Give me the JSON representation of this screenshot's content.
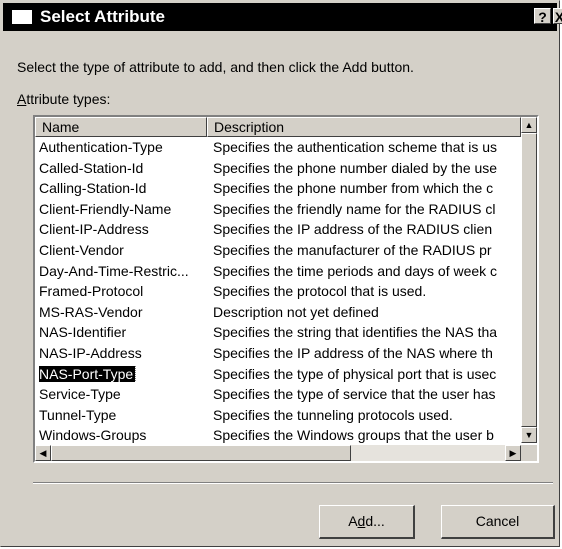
{
  "window": {
    "title": "Select Attribute",
    "help_glyph": "?",
    "close_glyph": "X"
  },
  "instruction": "Select the type of attribute to add, and then click the Add button.",
  "list": {
    "label_accel": "A",
    "label_rest": "ttribute types:",
    "columns": [
      "Name",
      "Description"
    ],
    "selected_index": 11,
    "rows": [
      {
        "name": "Authentication-Type",
        "description": "Specifies the authentication scheme that is us"
      },
      {
        "name": "Called-Station-Id",
        "description": "Specifies the phone number dialed by the use"
      },
      {
        "name": "Calling-Station-Id",
        "description": "Specifies the phone number from which the c"
      },
      {
        "name": "Client-Friendly-Name",
        "description": "Specifies the friendly name for the RADIUS cl"
      },
      {
        "name": "Client-IP-Address",
        "description": "Specifies the IP address of the RADIUS clien"
      },
      {
        "name": "Client-Vendor",
        "description": "Specifies the manufacturer of the RADIUS pr"
      },
      {
        "name": "Day-And-Time-Restric...",
        "description": "Specifies the time periods and days of week c"
      },
      {
        "name": "Framed-Protocol",
        "description": "Specifies the protocol that is used."
      },
      {
        "name": "MS-RAS-Vendor",
        "description": "Description not yet defined"
      },
      {
        "name": "NAS-Identifier",
        "description": "Specifies the string that identifies the NAS tha"
      },
      {
        "name": "NAS-IP-Address",
        "description": "Specifies the IP address of the NAS where th"
      },
      {
        "name": "NAS-Port-Type",
        "description": "Specifies the type of physical port that is usec"
      },
      {
        "name": "Service-Type",
        "description": "Specifies the type of service that the user has"
      },
      {
        "name": "Tunnel-Type",
        "description": "Specifies the tunneling protocols used."
      },
      {
        "name": "Windows-Groups",
        "description": "Specifies the Windows groups that the user b"
      }
    ]
  },
  "buttons": {
    "add_pre": "A",
    "add_accel": "d",
    "add_post": "d...",
    "cancel": "Cancel"
  },
  "colors": {
    "face": "#d4d0c8",
    "titlebar": "#000000",
    "selection": "#000000"
  }
}
